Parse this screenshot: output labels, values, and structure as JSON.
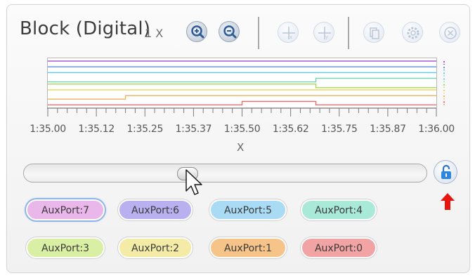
{
  "window": {
    "title": "Block (Digital)",
    "zoom_label": "1 X"
  },
  "toolbar": {
    "buttons": [
      {
        "icon": "zoom-in-icon",
        "enabled": true
      },
      {
        "icon": "zoom-out-icon",
        "enabled": true
      },
      {
        "icon": "cursor-x-icon",
        "enabled": false
      },
      {
        "icon": "cursor-y-icon",
        "enabled": false
      },
      {
        "icon": "copy-icon",
        "enabled": false
      },
      {
        "icon": "settings-icon",
        "enabled": false
      },
      {
        "icon": "close-icon",
        "enabled": false
      }
    ]
  },
  "plot": {
    "x_axis_label": "X",
    "tick_labels": [
      "1:35.00",
      "1:35.12",
      "1:35.25",
      "1:35.37",
      "1:35.50",
      "1:35.62",
      "1:35.75",
      "1:35.87",
      "1:36.00"
    ],
    "signals": [
      {
        "color": "#a65bd8",
        "segments": [
          [
            0,
            1,
            1
          ]
        ]
      },
      {
        "color": "#5b8fe0",
        "segments": [
          [
            0,
            1,
            1
          ]
        ]
      },
      {
        "color": "#5ec8e8",
        "segments": [
          [
            0,
            1,
            1
          ]
        ]
      },
      {
        "color": "#6fd3b6",
        "segments": [
          [
            0,
            0.69,
            0
          ],
          [
            0.69,
            1,
            1
          ]
        ]
      },
      {
        "color": "#a8d858",
        "segments": [
          [
            0,
            0.69,
            1
          ],
          [
            0.69,
            1,
            0
          ]
        ]
      },
      {
        "color": "#ead86a",
        "segments": [
          [
            0,
            1,
            1
          ]
        ]
      },
      {
        "color": "#f2b05a",
        "segments": [
          [
            0,
            0.2,
            0
          ],
          [
            0.2,
            1,
            1
          ]
        ]
      },
      {
        "color": "#e86c6c",
        "segments": [
          [
            0,
            0.5,
            0
          ],
          [
            0.5,
            0.69,
            1
          ],
          [
            0.69,
            1,
            0
          ]
        ]
      }
    ]
  },
  "slider": {
    "position": 0.4
  },
  "lock": {
    "icon": "unlock-icon",
    "hint_arrow_color": "#e8150f"
  },
  "channels": [
    {
      "label": "AuxPort:7",
      "color": "#e9b7ea",
      "selected": true
    },
    {
      "label": "AuxPort:6",
      "color": "#b9b0f0",
      "selected": false
    },
    {
      "label": "AuxPort:5",
      "color": "#a9dcf4",
      "selected": false
    },
    {
      "label": "AuxPort:4",
      "color": "#a9e9d8",
      "selected": false
    },
    {
      "label": "AuxPort:3",
      "color": "#d9f0a4",
      "selected": false
    },
    {
      "label": "AuxPort:2",
      "color": "#f4eca6",
      "selected": false
    },
    {
      "label": "AuxPort:1",
      "color": "#f6c488",
      "selected": false
    },
    {
      "label": "AuxPort:0",
      "color": "#f2a3a3",
      "selected": false
    }
  ]
}
